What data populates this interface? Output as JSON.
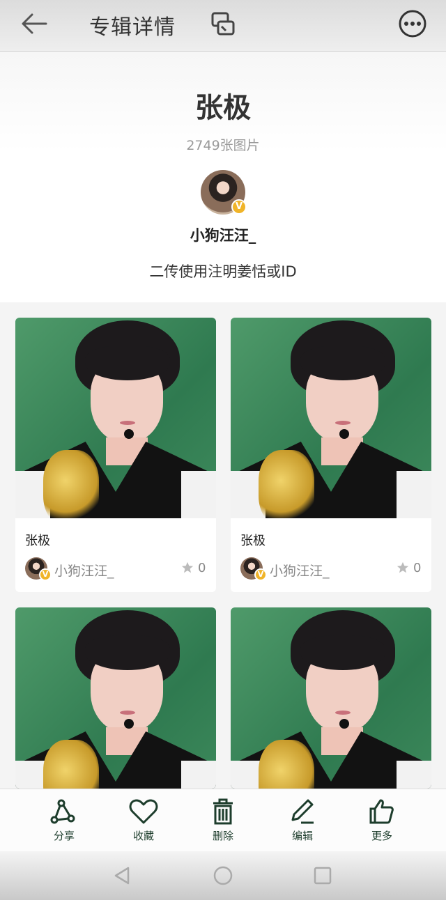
{
  "header": {
    "title": "专辑详情",
    "icons": [
      "arrow-left-icon",
      "switch-icon",
      "more-dots-icon"
    ]
  },
  "album": {
    "name": "张极",
    "photo_count": "2749张图片",
    "owner_name": "小狗汪汪_",
    "description": "二传使用注明姜恬或ID",
    "badge": "V"
  },
  "cards": [
    {
      "title": "张极",
      "author": "小狗汪汪_",
      "likes": "0",
      "badge": "V"
    },
    {
      "title": "张极",
      "author": "小狗汪汪_",
      "likes": "0",
      "badge": "V"
    },
    {
      "title": "",
      "author": "",
      "likes": "",
      "badge": ""
    },
    {
      "title": "",
      "author": "",
      "likes": "",
      "badge": ""
    }
  ],
  "toolbar": {
    "share": "分享",
    "favorite": "收藏",
    "delete": "删除",
    "edit": "编辑",
    "more": "更多"
  },
  "colors": {
    "toolbar_icon": "#1d3d2c",
    "badge": "#f0b429",
    "card_bg": "#ffffff",
    "photo_bg": "#3e8a5c"
  }
}
